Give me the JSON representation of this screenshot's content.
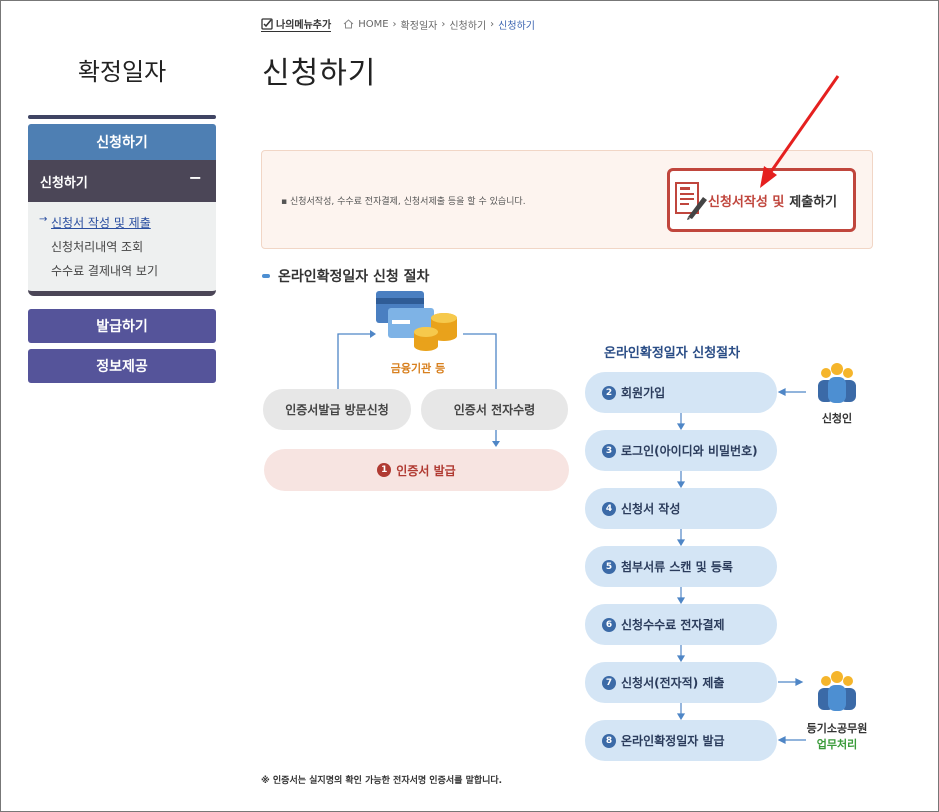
{
  "sidebar": {
    "title": "확정일자",
    "active_section": "신청하기",
    "sub_section": "신청하기",
    "sub_toggle": "−",
    "items": [
      {
        "label": "신청서 작성 및 제출"
      },
      {
        "label": "신청처리내역 조회"
      },
      {
        "label": "수수료 결제내역 보기"
      }
    ],
    "buttons": [
      {
        "label": "발급하기"
      },
      {
        "label": "정보제공"
      }
    ]
  },
  "breadcrumb": {
    "my_menu": "나의메뉴추가",
    "home": "HOME",
    "crumbs": [
      "확정일자",
      "신청하기",
      "신청하기"
    ]
  },
  "page_title": "신청하기",
  "info": {
    "text": "▪ 신청서작성, 수수료 전자결제, 신청서제출 등을 할 수 있습니다.",
    "apply_button_red": "신청서작성 및",
    "apply_button_dark": "제출하기"
  },
  "section_title": "온라인확정일자 신청 절차",
  "left_process": {
    "bank_label": "금융기관 등",
    "visit": "인증서발급 방문신청",
    "receive": "인증서 전자수령",
    "issue_num": "1",
    "issue": "인증서 발급"
  },
  "flow": {
    "title": "온라인확정일자 신청절차",
    "steps": [
      {
        "num": "2",
        "label": "회원가입"
      },
      {
        "num": "3",
        "label": "로그인(아이디와 비밀번호)"
      },
      {
        "num": "4",
        "label": "신청서 작성"
      },
      {
        "num": "5",
        "label": "첨부서류 스캔 및 등록"
      },
      {
        "num": "6",
        "label": "신청수수료 전자결제"
      },
      {
        "num": "7",
        "label": "신청서(전자적) 제출"
      },
      {
        "num": "8",
        "label": "온라인확정일자 발급"
      }
    ],
    "applicant": "신청인",
    "officer_line1": "등기소공무원",
    "officer_line2": "업무처리"
  },
  "footnote": "※ 인증서는 실지명의 확인 가능한 전자서명 인증서를 말합니다.",
  "colors": {
    "accent_red": "#c0463d",
    "step_bg": "#d4e5f5",
    "sidebar_active": "#4e7fb3",
    "sidebar_button": "#55549a"
  }
}
